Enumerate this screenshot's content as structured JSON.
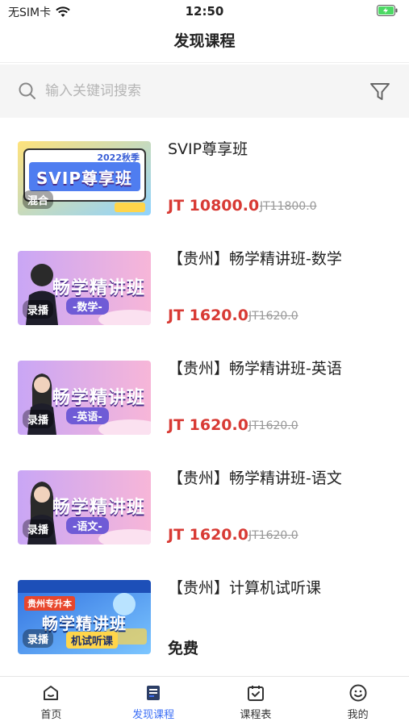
{
  "status_bar": {
    "carrier": "无SIM卡",
    "time": "12:50"
  },
  "header": {
    "title": "发现课程"
  },
  "search": {
    "placeholder": "输入关键词搜索"
  },
  "courses": [
    {
      "title": "SVIP尊享班",
      "price": "JT 10800.0",
      "original_price": "JT11800.0",
      "thumb_text": "SVIP尊享班",
      "thumb_badge": "2022秋季",
      "thumb_tag": "混合"
    },
    {
      "title": "【贵州】畅学精讲班-数学",
      "price": "JT 1620.0",
      "original_price": "JT1620.0",
      "thumb_text": "畅学精讲班",
      "thumb_sub": "-数学-",
      "thumb_tag": "录播"
    },
    {
      "title": "【贵州】畅学精讲班-英语",
      "price": "JT 1620.0",
      "original_price": "JT1620.0",
      "thumb_text": "畅学精讲班",
      "thumb_sub": "-英语-",
      "thumb_tag": "录播"
    },
    {
      "title": "【贵州】畅学精讲班-语文",
      "price": "JT 1620.0",
      "original_price": "JT1620.0",
      "thumb_text": "畅学精讲班",
      "thumb_sub": "-语文-",
      "thumb_tag": "录播"
    },
    {
      "title": "【贵州】计算机试听课",
      "price": "免费",
      "thumb_text": "畅学精讲班",
      "thumb_sub": "机试听课",
      "thumb_badge": "贵州专升本",
      "thumb_tag": "录播"
    }
  ],
  "tabbar": [
    {
      "label": "首页",
      "icon": "home-icon"
    },
    {
      "label": "发现课程",
      "icon": "discover-icon",
      "active": true
    },
    {
      "label": "课程表",
      "icon": "schedule-icon"
    },
    {
      "label": "我的",
      "icon": "profile-icon"
    }
  ],
  "colors": {
    "price": "#d83a34",
    "accent": "#3b6ef5"
  }
}
